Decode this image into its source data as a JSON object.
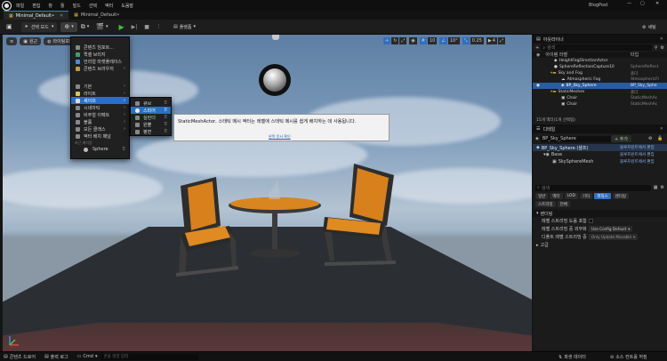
{
  "colors": {
    "accent": "#2f6fc4",
    "play": "#3fbf3f",
    "panel_bg": "#1b1b1b"
  },
  "titlebar": {
    "menu": [
      "파일",
      "편집",
      "창",
      "툴",
      "빌드",
      "선택",
      "액터",
      "도움말"
    ],
    "project": "BlogPost"
  },
  "tabs": [
    {
      "label": "Minimal_Default•"
    },
    {
      "label": "Minimal_Default•"
    }
  ],
  "toolbar": {
    "save_icon": "save-icon",
    "mode": "선택 모드",
    "platform": "플랫폼",
    "settings": "세팅"
  },
  "viewport": {
    "buttons": [
      "원근",
      "라이팅포함"
    ],
    "right_values": [
      "10",
      "10°",
      "0.25",
      "4"
    ]
  },
  "add_menu": {
    "items": [
      "콘텐츠 임포트...",
      "퀵셀 브리지",
      "언리얼 마켓플레이스",
      "콘텐츠 브라우저"
    ],
    "section_label": "기본",
    "categories": [
      "기본",
      "라이트",
      "셰이프",
      "시네마틱",
      "비주얼 이펙트",
      "볼륨",
      "모든 클래스",
      "액터 배치 패널"
    ],
    "recent_label": "최근 배치됨",
    "recent": [
      "Sphere"
    ]
  },
  "shapes_menu": {
    "items": [
      "큐브",
      "스피어",
      "실린더",
      "원뿔",
      "평면"
    ]
  },
  "tooltip": {
    "text": "StaticMeshActor, 스태틱 메시 액터는 레벨에 스태틱 메시를 쉽게 배치하는 데 사용됩니다.",
    "link": "왼쪽 문서 확인"
  },
  "outliner": {
    "title": "아웃라이너",
    "search": "검색",
    "col_label": "아이템 라벨",
    "col_type": "타입",
    "rows": [
      {
        "label": "HeightFogDirectionActor",
        "type": ""
      },
      {
        "label": "SphereReflectionCapture10",
        "type": "SphereReflect"
      },
      {
        "label": "Sky and Fog",
        "type": "폴더"
      },
      {
        "label": "Atmospheric Fog",
        "type": "AtmosphericFi"
      },
      {
        "label": "BP_Sky_Sphere",
        "type": "BP_Sky_Sphe"
      },
      {
        "label": "StaticMeshes",
        "type": "폴더"
      },
      {
        "label": "Chair",
        "type": "StaticMeshAc"
      },
      {
        "label": "Chair",
        "type": "StaticMeshAc"
      }
    ],
    "count": "15개 액터(1개 선택됨)"
  },
  "details": {
    "title": "디테일",
    "actor": "BP_Sky_Sphere",
    "add": "+ 추가",
    "root": "BP_Sky_Sphere (셀프)",
    "bp_link": "블루프린트에서 편집",
    "components": [
      {
        "label": "Base",
        "link": "블루프린트에서 편집"
      },
      {
        "label": "SkySphereMesh",
        "link": "블루프린트에서 편집"
      }
    ],
    "search": "검색",
    "cat_tabs_row1": [
      "일반",
      "액터",
      "LOD",
      "기타",
      "피직스",
      "렌더링"
    ],
    "cat_tabs_row2": [
      "스트리밍",
      "전체"
    ],
    "section": "렌더링",
    "props": [
      {
        "label": "레벨 스트리밍 도움 포함",
        "value": ""
      },
      {
        "label": "레벨 스트리밍 중 외부화",
        "value": "Use Config Default"
      },
      {
        "label": "디폴트 레벨 스트리밍 중",
        "value": "Only Update Movable"
      }
    ],
    "advanced": "고급"
  },
  "status": {
    "content_drawer": "콘텐츠 드로어",
    "output_log": "출력 로그",
    "cmd": "Cmd",
    "console_placeholder": "콘솔 명령 입력",
    "derived_data": "파생 데이터",
    "source_control": "소스 컨트롤 꺼짐"
  }
}
